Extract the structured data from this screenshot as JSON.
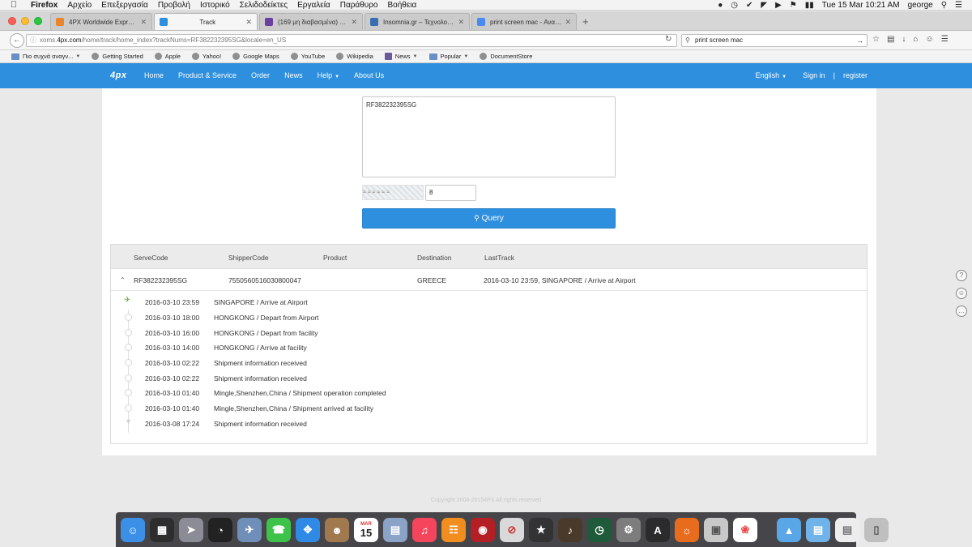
{
  "menubar": {
    "apple": "",
    "items": [
      "Firefox",
      "Αρχείο",
      "Επεξεργασία",
      "Προβολή",
      "Ιστορικό",
      "Σελιδοδείκτες",
      "Εργαλεία",
      "Παράθυρο",
      "Βοήθεια"
    ],
    "datetime": "Tue 15 Mar  10:21 AM",
    "user": "george"
  },
  "tabs": [
    {
      "label": "4PX Worldwide Express",
      "favicon_color": "#e9862b"
    },
    {
      "label": "Track",
      "favicon_color": "#2d8fdd"
    },
    {
      "label": "(169 μη διαβασμένα) - j_gr...",
      "favicon_color": "#6b3fa0"
    },
    {
      "label": "Insomnia.gr – Τεχνολογία, ...",
      "favicon_color": "#3b6db3"
    },
    {
      "label": "print screen mac - Αναζήτη...",
      "favicon_color": "#4a8af4"
    }
  ],
  "toolbar": {
    "url_prefix": "xoms.",
    "url_host": "4px.com",
    "url_rest": "/home/track/home_index?trackNums=RF382232395SG&locale=en_US",
    "search_value": "print screen mac"
  },
  "bookmarks": [
    {
      "label": "Πιο συχνά αναγν...",
      "has_menu": true,
      "icon": "folder"
    },
    {
      "label": "Getting Started",
      "has_menu": false,
      "icon": "globe"
    },
    {
      "label": "Apple",
      "has_menu": false,
      "icon": "globe"
    },
    {
      "label": "Yahoo!",
      "has_menu": false,
      "icon": "globe"
    },
    {
      "label": "Google Maps",
      "has_menu": false,
      "icon": "globe"
    },
    {
      "label": "YouTube",
      "has_menu": false,
      "icon": "globe"
    },
    {
      "label": "Wikipedia",
      "has_menu": false,
      "icon": "globe"
    },
    {
      "label": "News",
      "has_menu": true,
      "icon": "sq"
    },
    {
      "label": "Popular",
      "has_menu": true,
      "icon": "folder"
    },
    {
      "label": "DocumentStore",
      "has_menu": false,
      "icon": "globe"
    }
  ],
  "site": {
    "logo": "4px",
    "nav": [
      {
        "label": "Home",
        "has_menu": false
      },
      {
        "label": "Product & Service",
        "has_menu": false
      },
      {
        "label": "Order",
        "has_menu": false
      },
      {
        "label": "News",
        "has_menu": false
      },
      {
        "label": "Help",
        "has_menu": true
      },
      {
        "label": "About Us",
        "has_menu": false
      }
    ],
    "language": "English",
    "signin": "Sign in",
    "separator": "|",
    "register": "register"
  },
  "form": {
    "tracking_numbers": "RF382232395SG",
    "captcha_value": "8",
    "query_label": "Query"
  },
  "results": {
    "headers": [
      "ServeCode",
      "ShipperCode",
      "Product",
      "Destination",
      "LastTrack"
    ],
    "row": {
      "serve_code": "RF382232395SG",
      "shipper_code": "7550560516030800047",
      "product": "",
      "destination": "GREECE",
      "last_track": "2016-03-10 23:59,  SINGAPORE / Arrive at Airport"
    },
    "events": [
      {
        "time": "2016-03-10 23:59",
        "desc": "SINGAPORE / Arrive at Airport",
        "marker": "plane"
      },
      {
        "time": "2016-03-10 18:00",
        "desc": "HONGKONG / Depart from Airport",
        "marker": "dot"
      },
      {
        "time": "2016-03-10 16:00",
        "desc": "HONGKONG / Depart from facility",
        "marker": "dot"
      },
      {
        "time": "2016-03-10 14:00",
        "desc": "HONGKONG / Arrive at facility",
        "marker": "dot"
      },
      {
        "time": "2016-03-10 02:22",
        "desc": "Shipment information received",
        "marker": "dot"
      },
      {
        "time": "2016-03-10 02:22",
        "desc": "Shipment information received",
        "marker": "dot"
      },
      {
        "time": "2016-03-10 01:40",
        "desc": "Mingle,Shenzhen,China / Shipment operation completed",
        "marker": "dot"
      },
      {
        "time": "2016-03-10 01:40",
        "desc": "Mingle,Shenzhen,China / Shipment arrived at facility",
        "marker": "dot"
      },
      {
        "time": "2016-03-08 17:24",
        "desc": "Shipment information received",
        "marker": "end"
      }
    ]
  },
  "footer": {
    "copyright": "Copyright 2004-20154PX All rights reserved"
  },
  "dock": {
    "calendar_month": "MAR",
    "calendar_day": "15"
  },
  "colors": {
    "brand_blue": "#2d8fdd",
    "plane_green": "#67a83b"
  }
}
